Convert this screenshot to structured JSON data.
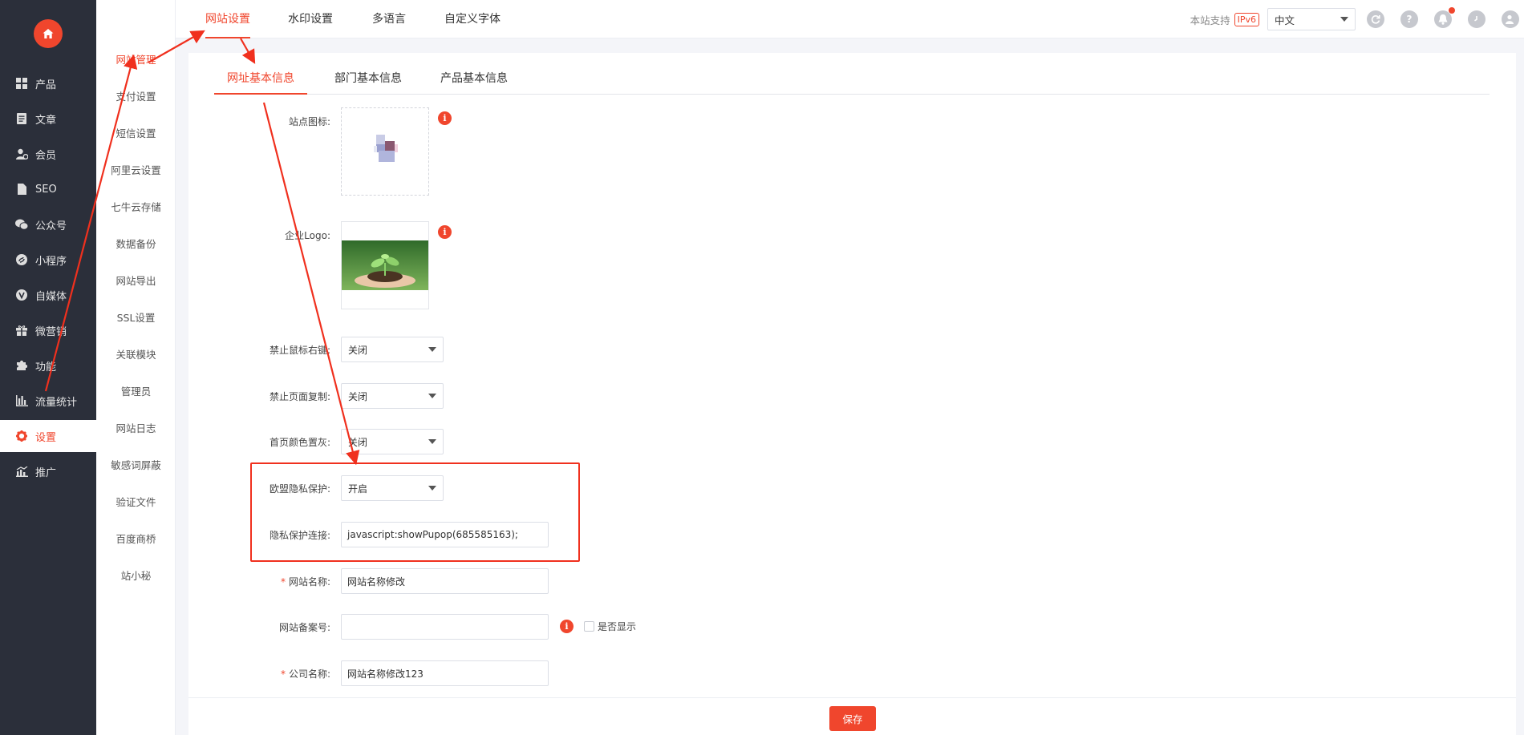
{
  "sidebar": {
    "items": [
      {
        "label": "产品",
        "icon": "grid-icon"
      },
      {
        "label": "文章",
        "icon": "document-icon"
      },
      {
        "label": "会员",
        "icon": "member-icon"
      },
      {
        "label": "SEO",
        "icon": "seo-file-icon"
      },
      {
        "label": "公众号",
        "icon": "wechat-icon"
      },
      {
        "label": "小程序",
        "icon": "mini-program-icon"
      },
      {
        "label": "自媒体",
        "icon": "media-icon"
      },
      {
        "label": "微营销",
        "icon": "gift-icon"
      },
      {
        "label": "功能",
        "icon": "puzzle-icon"
      },
      {
        "label": "流量统计",
        "icon": "bar-chart-icon"
      },
      {
        "label": "设置",
        "icon": "gear-icon"
      },
      {
        "label": "推广",
        "icon": "promote-chart-icon"
      }
    ],
    "active_index": 10
  },
  "subnav": {
    "items": [
      "网站管理",
      "支付设置",
      "短信设置",
      "阿里云设置",
      "七牛云存储",
      "数据备份",
      "网站导出",
      "SSL设置",
      "关联模块",
      "管理员",
      "网站日志",
      "敏感词屏蔽",
      "验证文件",
      "百度商桥",
      "站小秘"
    ],
    "active_index": 0
  },
  "topbar": {
    "tabs": [
      "网站设置",
      "水印设置",
      "多语言",
      "自定义字体"
    ],
    "active_index": 0,
    "support_text": "本站支持",
    "ipv6_badge": "IPv6",
    "language": "中文"
  },
  "content_tabs": {
    "tabs": [
      "网址基本信息",
      "部门基本信息",
      "产品基本信息"
    ],
    "active_index": 0
  },
  "form": {
    "site_icon_label": "站点图标:",
    "logo_label": "企业Logo:",
    "disable_right_click_label": "禁止鼠标右键:",
    "disable_right_click_value": "关闭",
    "disable_copy_label": "禁止页面复制:",
    "disable_copy_value": "关闭",
    "gray_home_label": "首页颜色置灰:",
    "gray_home_value": "关闭",
    "eu_privacy_label": "欧盟隐私保护:",
    "eu_privacy_value": "开启",
    "privacy_link_label": "隐私保护连接:",
    "privacy_link_value": "javascript:showPupop(685585163);",
    "site_name_required": "*",
    "site_name_label": "网站名称:",
    "site_name_value": "网站名称修改",
    "icp_label": "网站备案号:",
    "icp_value": "",
    "show_checkbox_label": "是否显示",
    "company_required": "*",
    "company_label": "公司名称:",
    "company_value": "网站名称修改123"
  },
  "save_label": "保存",
  "colors": {
    "accent": "#f0462d",
    "sidebar_bg": "#2b2f3a",
    "annotation": "#f0301e"
  }
}
